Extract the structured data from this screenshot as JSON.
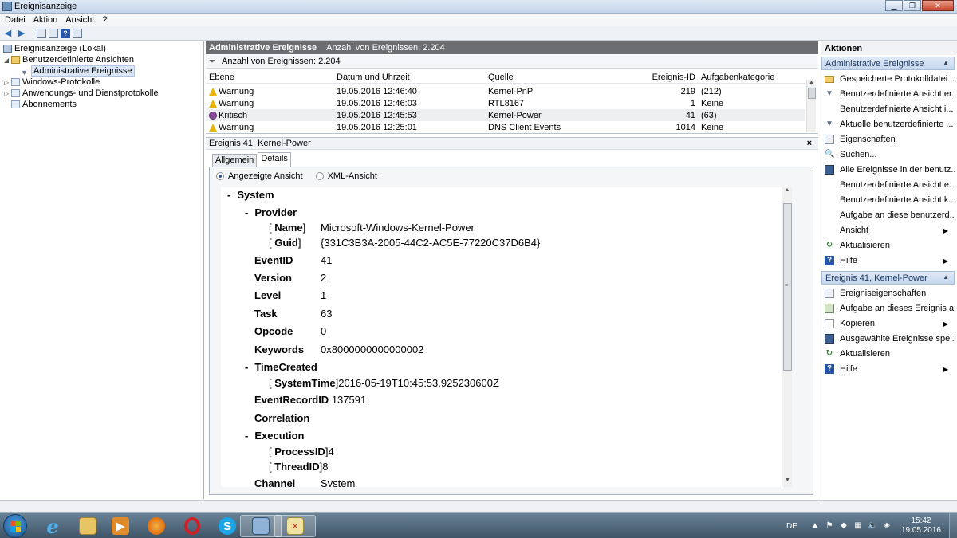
{
  "window": {
    "title": "Ereignisanzeige"
  },
  "menu": [
    "Datei",
    "Aktion",
    "Ansicht",
    "?"
  ],
  "tree": {
    "root": "Ereignisanzeige (Lokal)",
    "custom_views": "Benutzerdefinierte Ansichten",
    "admin_events": "Administrative Ereignisse",
    "windows_logs": "Windows-Protokolle",
    "app_service_logs": "Anwendungs- und Dienstprotokolle",
    "subscriptions": "Abonnements"
  },
  "center": {
    "header_title": "Administrative Ereignisse",
    "header_count": "Anzahl von Ereignissen: 2.204",
    "filter_text": "Anzahl von Ereignissen: 2.204",
    "columns": {
      "level": "Ebene",
      "datetime": "Datum und Uhrzeit",
      "source": "Quelle",
      "event_id": "Ereignis-ID",
      "category": "Aufgabenkategorie"
    },
    "rows": [
      {
        "level": "Warnung",
        "datetime": "19.05.2016 12:46:40",
        "source": "Kernel-PnP",
        "event_id": "219",
        "category": "(212)",
        "icon": "warning-icon"
      },
      {
        "level": "Warnung",
        "datetime": "19.05.2016 12:46:03",
        "source": "RTL8167",
        "event_id": "1",
        "category": "Keine",
        "icon": "warning-icon"
      },
      {
        "level": "Kritisch",
        "datetime": "19.05.2016 12:45:53",
        "source": "Kernel-Power",
        "event_id": "41",
        "category": "(63)",
        "icon": "critical-icon"
      },
      {
        "level": "Warnung",
        "datetime": "19.05.2016 12:25:01",
        "source": "DNS Client Events",
        "event_id": "1014",
        "category": "Keine",
        "icon": "warning-icon"
      }
    ]
  },
  "detail": {
    "title": "Ereignis 41, Kernel-Power",
    "close": "×",
    "tab_general": "Allgemein",
    "tab_details": "Details",
    "radio_friendly": "Angezeigte Ansicht",
    "radio_xml": "XML-Ansicht",
    "xml": {
      "system": "System",
      "provider": "Provider",
      "name_key": "Name",
      "name_val": "Microsoft-Windows-Kernel-Power",
      "guid_key": "Guid",
      "guid_val": "{331C3B3A-2005-44C2-AC5E-77220C37D6B4}",
      "eventid_key": "EventID",
      "eventid_val": "41",
      "version_key": "Version",
      "version_val": "2",
      "level_key": "Level",
      "level_val": "1",
      "task_key": "Task",
      "task_val": "63",
      "opcode_key": "Opcode",
      "opcode_val": "0",
      "keywords_key": "Keywords",
      "keywords_val": "0x8000000000000002",
      "timecreated": "TimeCreated",
      "systemtime_key": "SystemTime",
      "systemtime_val": "2016-05-19T10:45:53.925230600Z",
      "recordid_key": "EventRecordID",
      "recordid_val": "137591",
      "correlation": "Correlation",
      "execution": "Execution",
      "processid_key": "ProcessID",
      "processid_val": "4",
      "threadid_key": "ThreadID",
      "threadid_val": "8",
      "channel_key": "Channel",
      "channel_val": "System"
    }
  },
  "actions": {
    "title": "Aktionen",
    "section1": "Administrative Ereignisse",
    "section1_items": [
      {
        "label": "Gespeicherte Protokolldatei ...",
        "icon": "open-icon",
        "submenu": false
      },
      {
        "label": "Benutzerdefinierte Ansicht er...",
        "icon": "filter-icon",
        "submenu": false
      },
      {
        "label": "Benutzerdefinierte Ansicht i...",
        "icon": "",
        "submenu": false
      },
      {
        "label": "Aktuelle benutzerdefinierte ...",
        "icon": "filter-icon",
        "submenu": false
      },
      {
        "label": "Eigenschaften",
        "icon": "properties-icon",
        "submenu": false
      },
      {
        "label": "Suchen...",
        "icon": "find-icon",
        "submenu": false
      },
      {
        "label": "Alle Ereignisse in der benutz...",
        "icon": "save-icon",
        "submenu": false
      },
      {
        "label": "Benutzerdefinierte Ansicht e...",
        "icon": "",
        "submenu": false
      },
      {
        "label": "Benutzerdefinierte Ansicht k...",
        "icon": "",
        "submenu": false
      },
      {
        "label": "Aufgabe an diese benutzerd...",
        "icon": "",
        "submenu": false
      },
      {
        "label": "Ansicht",
        "icon": "",
        "submenu": true
      },
      {
        "label": "Aktualisieren",
        "icon": "refresh-icon",
        "submenu": false
      },
      {
        "label": "Hilfe",
        "icon": "help-icon",
        "submenu": true
      }
    ],
    "section2": "Ereignis 41, Kernel-Power",
    "section2_items": [
      {
        "label": "Ereigniseigenschaften",
        "icon": "properties-icon",
        "submenu": false
      },
      {
        "label": "Aufgabe an dieses Ereignis a...",
        "icon": "task-icon",
        "submenu": false
      },
      {
        "label": "Kopieren",
        "icon": "copy-icon",
        "submenu": true
      },
      {
        "label": "Ausgewählte Ereignisse spei...",
        "icon": "save-icon",
        "submenu": false
      },
      {
        "label": "Aktualisieren",
        "icon": "refresh-icon",
        "submenu": false
      },
      {
        "label": "Hilfe",
        "icon": "help-icon",
        "submenu": true
      }
    ]
  },
  "taskbar": {
    "lang": "DE",
    "time": "15:42",
    "date": "19.05.2016"
  }
}
